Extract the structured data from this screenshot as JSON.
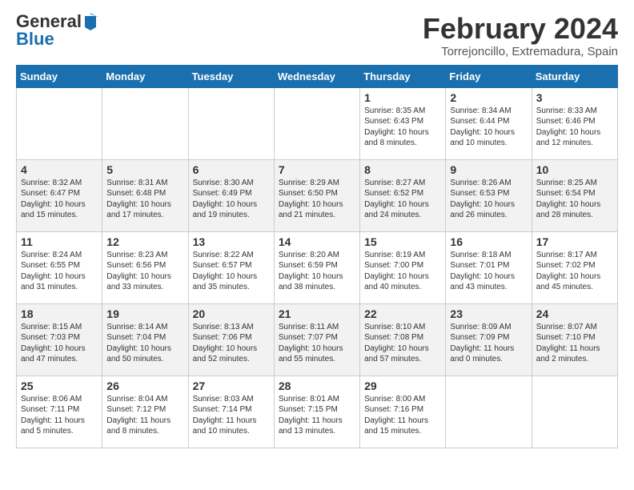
{
  "logo": {
    "general": "General",
    "blue": "Blue"
  },
  "calendar": {
    "title": "February 2024",
    "subtitle": "Torrejoncillo, Extremadura, Spain"
  },
  "headers": [
    "Sunday",
    "Monday",
    "Tuesday",
    "Wednesday",
    "Thursday",
    "Friday",
    "Saturday"
  ],
  "weeks": [
    [
      {
        "day": "",
        "info": ""
      },
      {
        "day": "",
        "info": ""
      },
      {
        "day": "",
        "info": ""
      },
      {
        "day": "",
        "info": ""
      },
      {
        "day": "1",
        "info": "Sunrise: 8:35 AM\nSunset: 6:43 PM\nDaylight: 10 hours\nand 8 minutes."
      },
      {
        "day": "2",
        "info": "Sunrise: 8:34 AM\nSunset: 6:44 PM\nDaylight: 10 hours\nand 10 minutes."
      },
      {
        "day": "3",
        "info": "Sunrise: 8:33 AM\nSunset: 6:46 PM\nDaylight: 10 hours\nand 12 minutes."
      }
    ],
    [
      {
        "day": "4",
        "info": "Sunrise: 8:32 AM\nSunset: 6:47 PM\nDaylight: 10 hours\nand 15 minutes."
      },
      {
        "day": "5",
        "info": "Sunrise: 8:31 AM\nSunset: 6:48 PM\nDaylight: 10 hours\nand 17 minutes."
      },
      {
        "day": "6",
        "info": "Sunrise: 8:30 AM\nSunset: 6:49 PM\nDaylight: 10 hours\nand 19 minutes."
      },
      {
        "day": "7",
        "info": "Sunrise: 8:29 AM\nSunset: 6:50 PM\nDaylight: 10 hours\nand 21 minutes."
      },
      {
        "day": "8",
        "info": "Sunrise: 8:27 AM\nSunset: 6:52 PM\nDaylight: 10 hours\nand 24 minutes."
      },
      {
        "day": "9",
        "info": "Sunrise: 8:26 AM\nSunset: 6:53 PM\nDaylight: 10 hours\nand 26 minutes."
      },
      {
        "day": "10",
        "info": "Sunrise: 8:25 AM\nSunset: 6:54 PM\nDaylight: 10 hours\nand 28 minutes."
      }
    ],
    [
      {
        "day": "11",
        "info": "Sunrise: 8:24 AM\nSunset: 6:55 PM\nDaylight: 10 hours\nand 31 minutes."
      },
      {
        "day": "12",
        "info": "Sunrise: 8:23 AM\nSunset: 6:56 PM\nDaylight: 10 hours\nand 33 minutes."
      },
      {
        "day": "13",
        "info": "Sunrise: 8:22 AM\nSunset: 6:57 PM\nDaylight: 10 hours\nand 35 minutes."
      },
      {
        "day": "14",
        "info": "Sunrise: 8:20 AM\nSunset: 6:59 PM\nDaylight: 10 hours\nand 38 minutes."
      },
      {
        "day": "15",
        "info": "Sunrise: 8:19 AM\nSunset: 7:00 PM\nDaylight: 10 hours\nand 40 minutes."
      },
      {
        "day": "16",
        "info": "Sunrise: 8:18 AM\nSunset: 7:01 PM\nDaylight: 10 hours\nand 43 minutes."
      },
      {
        "day": "17",
        "info": "Sunrise: 8:17 AM\nSunset: 7:02 PM\nDaylight: 10 hours\nand 45 minutes."
      }
    ],
    [
      {
        "day": "18",
        "info": "Sunrise: 8:15 AM\nSunset: 7:03 PM\nDaylight: 10 hours\nand 47 minutes."
      },
      {
        "day": "19",
        "info": "Sunrise: 8:14 AM\nSunset: 7:04 PM\nDaylight: 10 hours\nand 50 minutes."
      },
      {
        "day": "20",
        "info": "Sunrise: 8:13 AM\nSunset: 7:06 PM\nDaylight: 10 hours\nand 52 minutes."
      },
      {
        "day": "21",
        "info": "Sunrise: 8:11 AM\nSunset: 7:07 PM\nDaylight: 10 hours\nand 55 minutes."
      },
      {
        "day": "22",
        "info": "Sunrise: 8:10 AM\nSunset: 7:08 PM\nDaylight: 10 hours\nand 57 minutes."
      },
      {
        "day": "23",
        "info": "Sunrise: 8:09 AM\nSunset: 7:09 PM\nDaylight: 11 hours\nand 0 minutes."
      },
      {
        "day": "24",
        "info": "Sunrise: 8:07 AM\nSunset: 7:10 PM\nDaylight: 11 hours\nand 2 minutes."
      }
    ],
    [
      {
        "day": "25",
        "info": "Sunrise: 8:06 AM\nSunset: 7:11 PM\nDaylight: 11 hours\nand 5 minutes."
      },
      {
        "day": "26",
        "info": "Sunrise: 8:04 AM\nSunset: 7:12 PM\nDaylight: 11 hours\nand 8 minutes."
      },
      {
        "day": "27",
        "info": "Sunrise: 8:03 AM\nSunset: 7:14 PM\nDaylight: 11 hours\nand 10 minutes."
      },
      {
        "day": "28",
        "info": "Sunrise: 8:01 AM\nSunset: 7:15 PM\nDaylight: 11 hours\nand 13 minutes."
      },
      {
        "day": "29",
        "info": "Sunrise: 8:00 AM\nSunset: 7:16 PM\nDaylight: 11 hours\nand 15 minutes."
      },
      {
        "day": "",
        "info": ""
      },
      {
        "day": "",
        "info": ""
      }
    ]
  ]
}
